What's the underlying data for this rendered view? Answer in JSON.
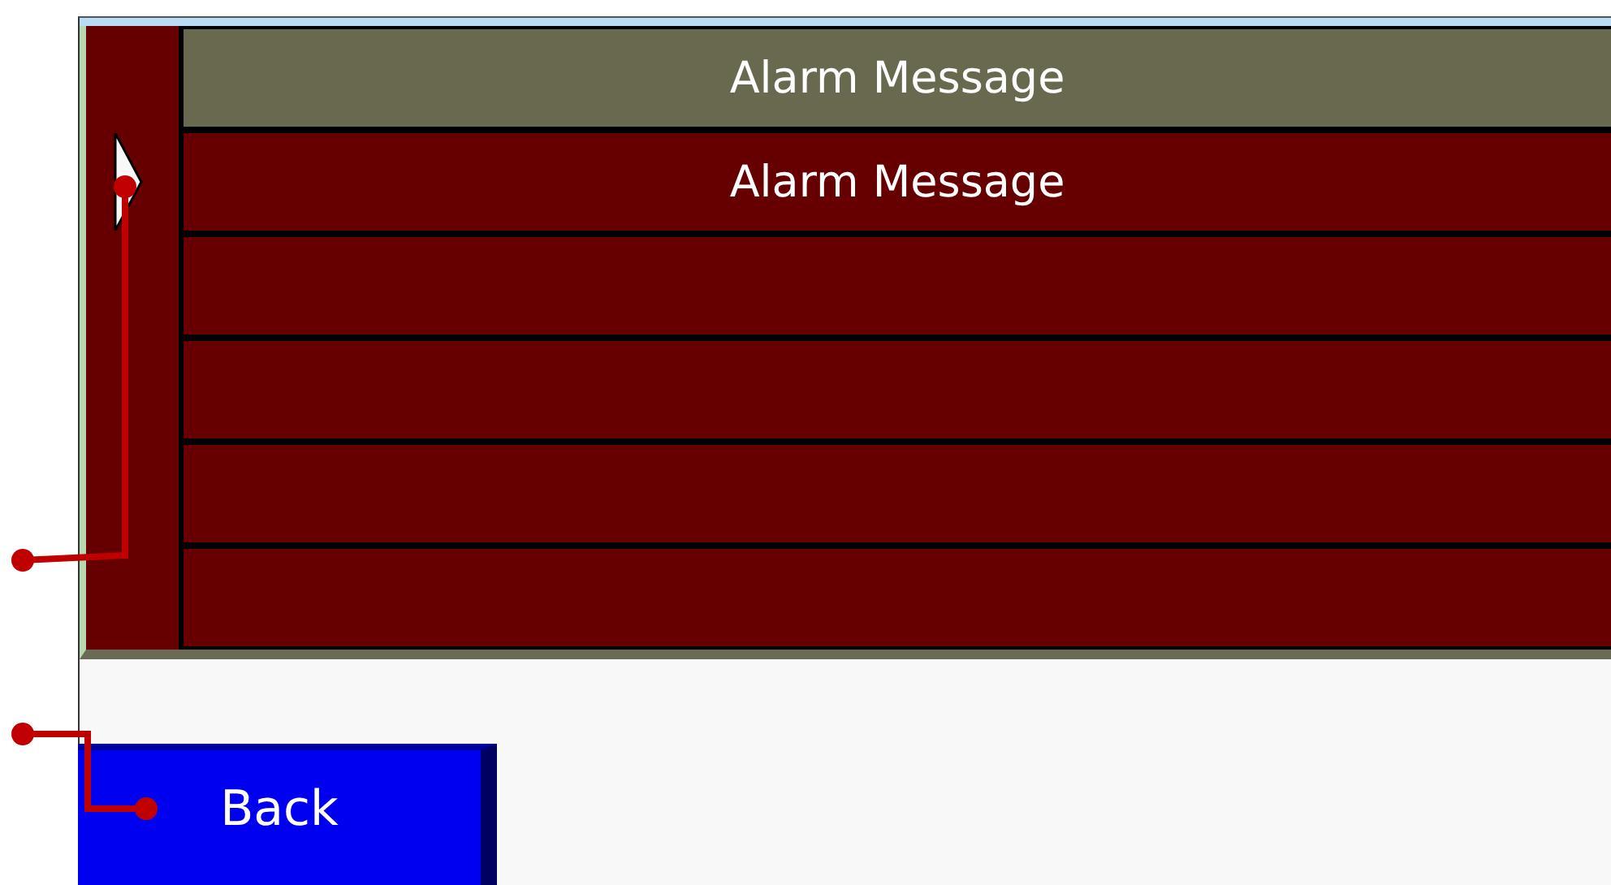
{
  "alarm_table": {
    "header": "Alarm Message",
    "rows": [
      {
        "text": "Alarm Message",
        "selected": true
      },
      {
        "selected": false
      },
      {
        "selected": false
      },
      {
        "selected": false
      },
      {
        "selected": false
      }
    ]
  },
  "buttons": [
    {
      "label": "Back"
    }
  ]
}
